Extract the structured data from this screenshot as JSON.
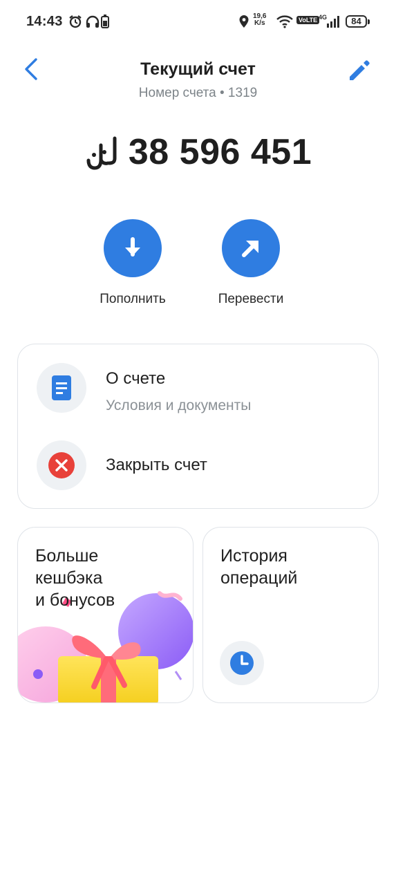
{
  "status_bar": {
    "time": "14:43",
    "net_speed_value": "19,6",
    "net_speed_unit": "K/s",
    "volte": "VoLTE",
    "network": "4G",
    "battery": "84"
  },
  "header": {
    "title": "Текущий счет",
    "subtitle": "Номер счета • 1319"
  },
  "balance": {
    "amount": "38 596 451",
    "currency_icon": "rial-sign-icon"
  },
  "actions": [
    {
      "label": "Пополнить",
      "icon": "arrow-down-icon"
    },
    {
      "label": "Перевести",
      "icon": "arrow-up-right-icon"
    }
  ],
  "account_card": {
    "about_title": "О счете",
    "about_sub": "Условия и документы",
    "close_title": "Закрыть счет"
  },
  "tiles": {
    "bonus_title": "Больше\nкешбэка\nи бонусов",
    "history_title": "История\nопераций"
  },
  "colors": {
    "accent": "#2f7de1",
    "danger": "#e8413a",
    "muted": "#7d8489"
  }
}
